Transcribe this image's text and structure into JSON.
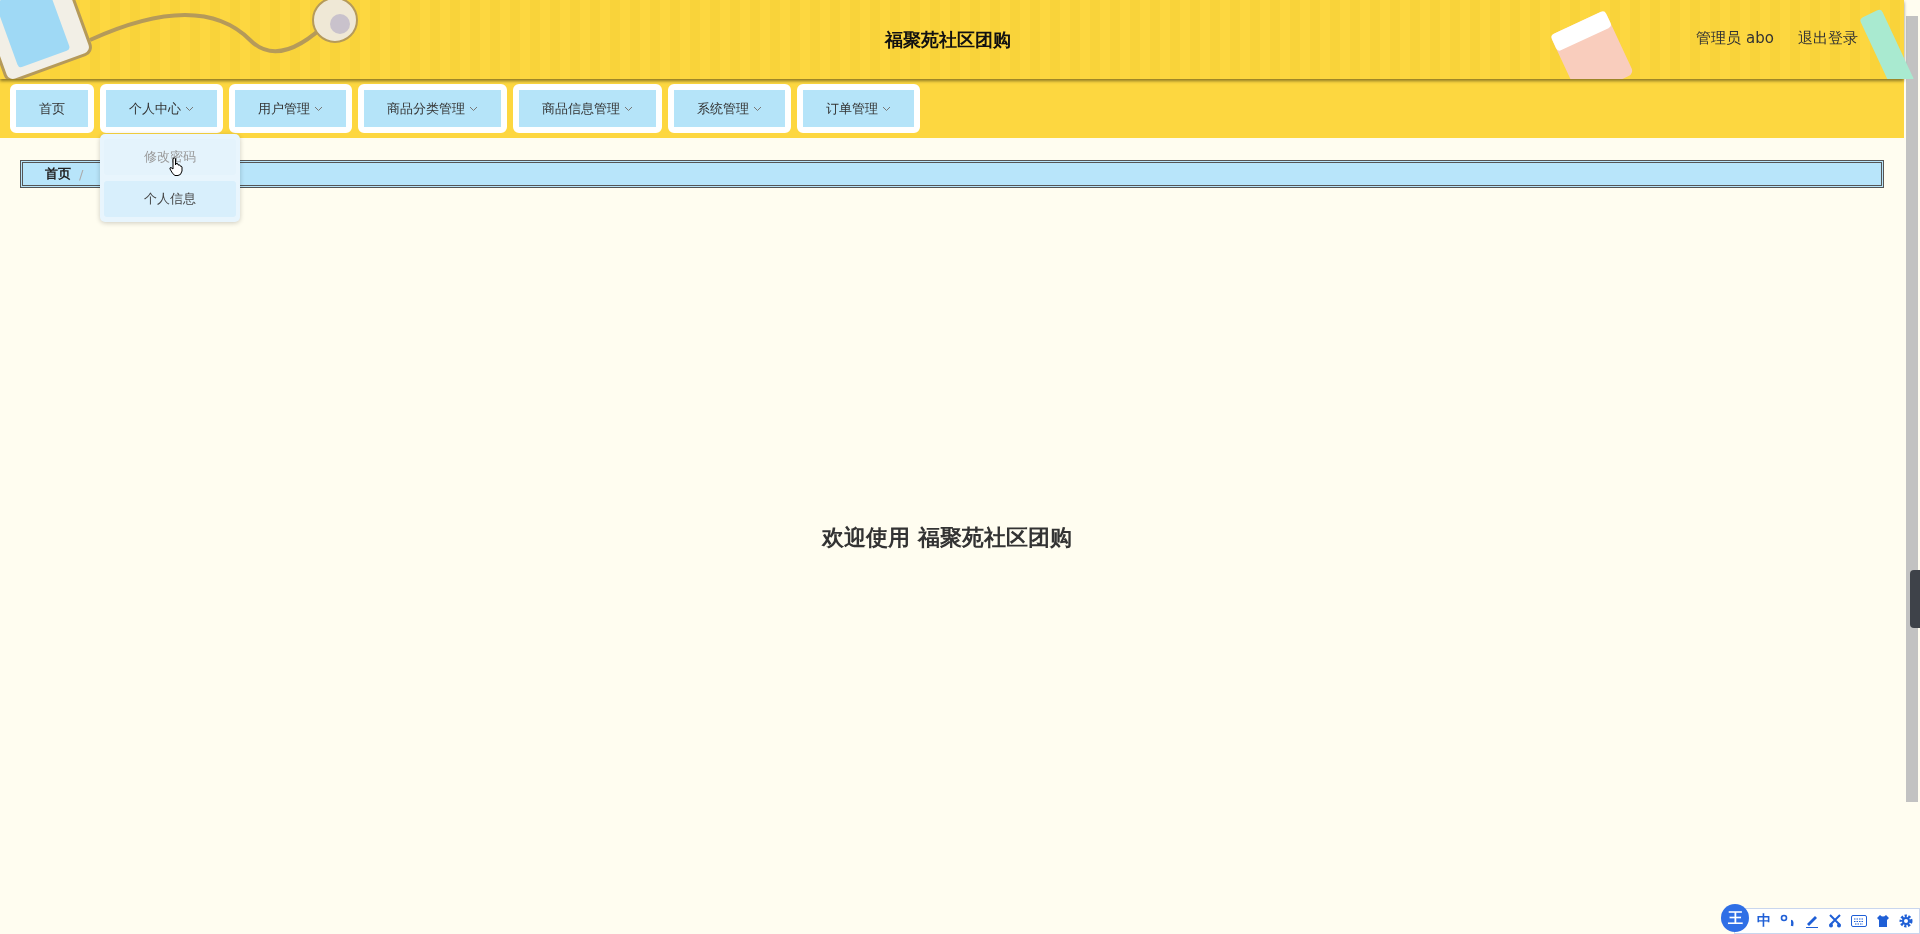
{
  "header": {
    "title": "福聚苑社区团购",
    "user": "管理员 abo",
    "logout": "退出登录"
  },
  "nav": [
    {
      "label": "首页",
      "has_menu": false
    },
    {
      "label": "个人中心",
      "has_menu": true,
      "menu": [
        {
          "label": "修改密码",
          "hovered": true
        },
        {
          "label": "个人信息",
          "hovered": false
        }
      ]
    },
    {
      "label": "用户管理",
      "has_menu": true
    },
    {
      "label": "商品分类管理",
      "has_menu": true
    },
    {
      "label": "商品信息管理",
      "has_menu": true
    },
    {
      "label": "系统管理",
      "has_menu": true
    },
    {
      "label": "订单管理",
      "has_menu": true
    }
  ],
  "breadcrumb": {
    "items": [
      "首页"
    ],
    "separator": "/"
  },
  "welcome": "欢迎使用 福聚苑社区团购",
  "ime_toolbar": {
    "logo": "王",
    "mode": "中"
  }
}
